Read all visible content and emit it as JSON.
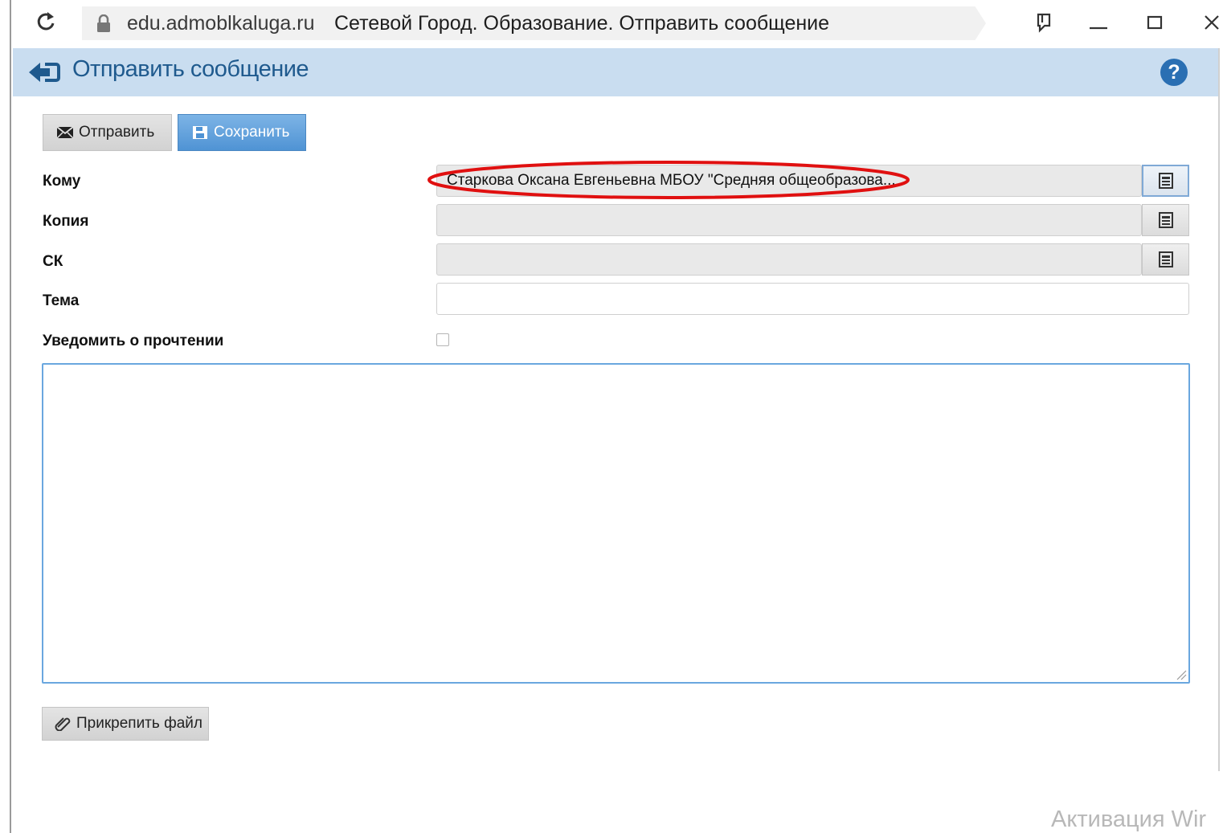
{
  "browser": {
    "domain": "edu.admoblkaluga.ru",
    "page_title": "Сетевой Город. Образование. Отправить сообщение"
  },
  "header": {
    "title": "Отправить сообщение",
    "help_glyph": "?"
  },
  "toolbar": {
    "send_label": "Отправить",
    "save_label": "Сохранить"
  },
  "form": {
    "to_label": "Кому",
    "to_value": "Старкова Оксана Евгеньевна МБОУ \"Средняя общеобразова...",
    "cc_label": "Копия",
    "cc_value": "",
    "bcc_label": "СК",
    "bcc_value": "",
    "subject_label": "Тема",
    "subject_value": "",
    "read_receipt_label": "Уведомить о прочтении",
    "read_receipt_checked": false,
    "body_value": ""
  },
  "attach": {
    "label": "Прикрепить файл"
  },
  "watermark": {
    "text": "Активация Wir"
  },
  "colors": {
    "header_bg": "#c9ddf0",
    "title_color": "#1f5a8e",
    "save_button": "#4f93d4",
    "highlight_ellipse": "#e01010"
  }
}
